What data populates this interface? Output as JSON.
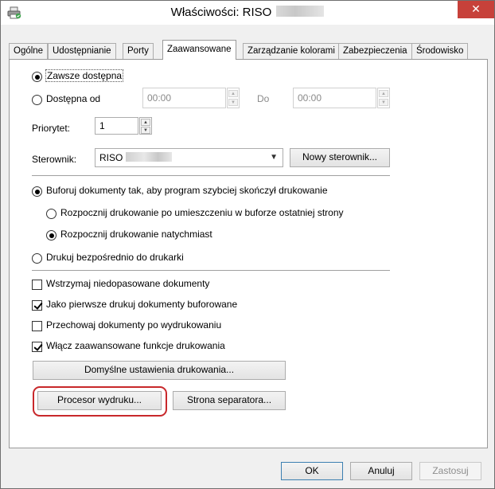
{
  "window": {
    "title": "Właściwości: RISO",
    "close_glyph": "✕"
  },
  "tabs": [
    {
      "label": "Ogólne",
      "active": false
    },
    {
      "label": "Udostępnianie",
      "active": false
    },
    {
      "label": "Porty",
      "active": false
    },
    {
      "label": "Zaawansowane",
      "active": true
    },
    {
      "label": "Zarządzanie kolorami",
      "active": false
    },
    {
      "label": "Zabezpieczenia",
      "active": false
    },
    {
      "label": "Środowisko",
      "active": false
    }
  ],
  "availability": {
    "always_label": "Zawsze dostępna",
    "always_selected": true,
    "from_label": "Dostępna od",
    "from_selected": false,
    "from_time": "00:00",
    "to_label": "Do",
    "to_time": "00:00"
  },
  "priority": {
    "label": "Priorytet:",
    "value": "1"
  },
  "driver": {
    "label": "Sterownik:",
    "value": "RISO",
    "new_driver_button": "Nowy sterownik..."
  },
  "spool": {
    "buffer_label": "Buforuj dokumenty tak, aby program szybciej skończył drukowanie",
    "buffer_selected": true,
    "start_after_last_page_label": "Rozpocznij drukowanie po umieszczeniu w buforze ostatniej strony",
    "start_after_last_page_selected": false,
    "start_immediately_label": "Rozpocznij drukowanie natychmiast",
    "start_immediately_selected": true,
    "direct_label": "Drukuj bezpośrednio do drukarki",
    "direct_selected": false
  },
  "options": [
    {
      "label": "Wstrzymaj niedopasowane dokumenty",
      "checked": false
    },
    {
      "label": "Jako pierwsze drukuj dokumenty buforowane",
      "checked": true
    },
    {
      "label": "Przechowaj dokumenty po wydrukowaniu",
      "checked": false
    },
    {
      "label": "Włącz zaawansowane funkcje drukowania",
      "checked": true
    }
  ],
  "buttons": {
    "print_defaults": "Domyślne ustawienia drukowania...",
    "print_processor": "Procesor wydruku...",
    "separator_page": "Strona separatora...",
    "ok": "OK",
    "cancel": "Anuluj",
    "apply": "Zastosuj"
  },
  "colors": {
    "close_button": "#c7413a",
    "highlight_border": "#c8282b"
  }
}
